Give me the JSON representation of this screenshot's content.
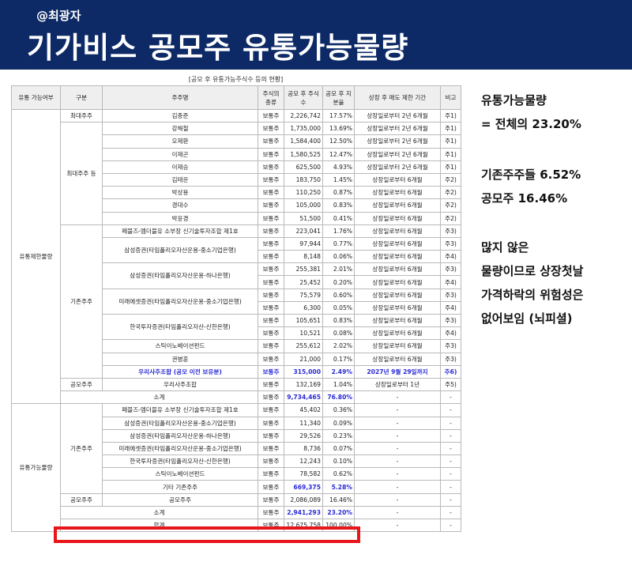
{
  "header": {
    "handle": "@최광자",
    "title": "기가비스 공모주 유통가능물량"
  },
  "caption": "[공모 후 유통가능주식수 등의 현황]",
  "columns": [
    "유통 가능여부",
    "구분",
    "주주명",
    "주식의 종류",
    "공모 후 주식수",
    "공모 후 지분율",
    "상장 후 매도 제한 기간",
    "비고"
  ],
  "groups": {
    "restricted": "유통제한물량",
    "tradable": "유통가능물량",
    "total": "합계"
  },
  "cats": {
    "largest": "최대주주",
    "largest_rel": "최대주주 등",
    "existing": "기존주주",
    "ipo": "공모주주",
    "subtotal": "소계"
  },
  "rows": [
    {
      "name": "김종준",
      "type": "보통주",
      "shares": "2,226,742",
      "pct": "17.57%",
      "lock": "상장일로부터 2년 6개월",
      "note": "주1)"
    },
    {
      "name": "강해철",
      "type": "보통주",
      "shares": "1,735,000",
      "pct": "13.69%",
      "lock": "상장일로부터 2년 6개월",
      "note": "주1)"
    },
    {
      "name": "오제환",
      "type": "보통주",
      "shares": "1,584,400",
      "pct": "12.50%",
      "lock": "상장일로부터 2년 6개월",
      "note": "주1)"
    },
    {
      "name": "이재곤",
      "type": "보통주",
      "shares": "1,580,525",
      "pct": "12.47%",
      "lock": "상장일로부터 2년 6개월",
      "note": "주1)"
    },
    {
      "name": "이재승",
      "type": "보통주",
      "shares": "625,500",
      "pct": "4.93%",
      "lock": "상장일로부터 2년 6개월",
      "note": "주1)"
    },
    {
      "name": "김태운",
      "type": "보통주",
      "shares": "183,750",
      "pct": "1.45%",
      "lock": "상장일로부터 6개월",
      "note": "주2)"
    },
    {
      "name": "박상용",
      "type": "보통주",
      "shares": "110,250",
      "pct": "0.87%",
      "lock": "상장일로부터 6개월",
      "note": "주2)"
    },
    {
      "name": "경대수",
      "type": "보통주",
      "shares": "105,000",
      "pct": "0.83%",
      "lock": "상장일로부터 6개월",
      "note": "주2)"
    },
    {
      "name": "박윤경",
      "type": "보통주",
      "shares": "51,500",
      "pct": "0.41%",
      "lock": "상장일로부터 6개월",
      "note": "주2)"
    },
    {
      "name": "페블즈-엠더블유 소부장 신기술투자조합 제1호",
      "type": "보통주",
      "shares": "223,041",
      "pct": "1.76%",
      "lock": "상장일로부터 6개월",
      "note": "주3)"
    },
    {
      "name": "삼성증권(타임폴리오자산운용-중소기업은행)",
      "type": "보통주",
      "shares": "97,944",
      "pct": "0.77%",
      "lock": "상장일로부터 6개월",
      "note": "주3)"
    },
    {
      "type": "보통주",
      "shares": "8,148",
      "pct": "0.06%",
      "lock": "상장일로부터 6개월",
      "note": "주4)"
    },
    {
      "name": "삼성증권(타임폴리오자산운용-하나은행)",
      "type": "보통주",
      "shares": "255,381",
      "pct": "2.01%",
      "lock": "상장일로부터 6개월",
      "note": "주3)"
    },
    {
      "type": "보통주",
      "shares": "25,452",
      "pct": "0.20%",
      "lock": "상장일로부터 6개월",
      "note": "주4)"
    },
    {
      "name": "미래에셋증권(타임폴리오자산운용-중소기업은행)",
      "type": "보통주",
      "shares": "75,579",
      "pct": "0.60%",
      "lock": "상장일로부터 6개월",
      "note": "주3)"
    },
    {
      "type": "보통주",
      "shares": "6,300",
      "pct": "0.05%",
      "lock": "상장일로부터 6개월",
      "note": "주4)"
    },
    {
      "name": "한국투자증권(타임폴리오자산-신한은행)",
      "type": "보통주",
      "shares": "105,651",
      "pct": "0.83%",
      "lock": "상장일로부터 6개월",
      "note": "주3)"
    },
    {
      "type": "보통주",
      "shares": "10,521",
      "pct": "0.08%",
      "lock": "상장일로부터 6개월",
      "note": "주4)"
    },
    {
      "name": "스틱이노베이션펀드",
      "type": "보통주",
      "shares": "255,612",
      "pct": "2.02%",
      "lock": "상장일로부터 6개월",
      "note": "주3)"
    },
    {
      "name": "권병훈",
      "type": "보통주",
      "shares": "21,000",
      "pct": "0.17%",
      "lock": "상장일로부터 6개월",
      "note": "주3)"
    },
    {
      "name": "우리사주조합 (공모 이전 보유분)",
      "type": "보통주",
      "shares": "315,000",
      "pct": "2.49%",
      "lock": "2027년 9월 29일까지",
      "note": "주6)"
    },
    {
      "name": "우리사주조합",
      "type": "보통주",
      "shares": "132,169",
      "pct": "1.04%",
      "lock": "상장일로부터 1년",
      "note": "주5)"
    },
    {
      "type": "보통주",
      "shares": "9,734,465",
      "pct": "76.80%",
      "lock": "-",
      "note": "-"
    },
    {
      "name": "페블즈-엠더블유 소부장 신기술투자조합 제1호",
      "type": "보통주",
      "shares": "45,402",
      "pct": "0.36%",
      "lock": "-",
      "note": "-"
    },
    {
      "name": "삼성증권(타임폴리오자산운용-중소기업은행)",
      "type": "보통주",
      "shares": "11,340",
      "pct": "0.09%",
      "lock": "-",
      "note": "-"
    },
    {
      "name": "삼성증권(타임폴리오자산운용-하나은행)",
      "type": "보통주",
      "shares": "29,526",
      "pct": "0.23%",
      "lock": "-",
      "note": "-"
    },
    {
      "name": "미래에셋증권(타임폴리오자산운용-중소기업은행)",
      "type": "보통주",
      "shares": "8,736",
      "pct": "0.07%",
      "lock": "-",
      "note": "-"
    },
    {
      "name": "한국투자증권(타임폴리오자산-신한은행)",
      "type": "보통주",
      "shares": "12,243",
      "pct": "0.10%",
      "lock": "-",
      "note": "-"
    },
    {
      "name": "스틱이노베이션펀드",
      "type": "보통주",
      "shares": "78,582",
      "pct": "0.62%",
      "lock": "-",
      "note": "-"
    },
    {
      "name": "기타 기존주주",
      "type": "보통주",
      "shares": "669,375",
      "pct": "5.28%",
      "lock": "-",
      "note": "-"
    },
    {
      "name": "공모주주",
      "type": "보통주",
      "shares": "2,086,089",
      "pct": "16.46%",
      "lock": "-",
      "note": "-"
    },
    {
      "type": "보통주",
      "shares": "2,941,293",
      "pct": "23.20%",
      "lock": "-",
      "note": "-"
    },
    {
      "type": "보통주",
      "shares": "12,675,758",
      "pct": "100.00%",
      "lock": "-",
      "note": "-"
    }
  ],
  "notes": {
    "l1": "유통가능물량",
    "l2": "= 전체의 23.20%",
    "l3": "기존주주들 6.52%",
    "l4": "공모주 16.46%",
    "l5": "많지 않은",
    "l6": "물량이므로 상장첫날",
    "l7": "가격하락의 위험성은",
    "l8": "없어보임 (뇌피셜)"
  }
}
